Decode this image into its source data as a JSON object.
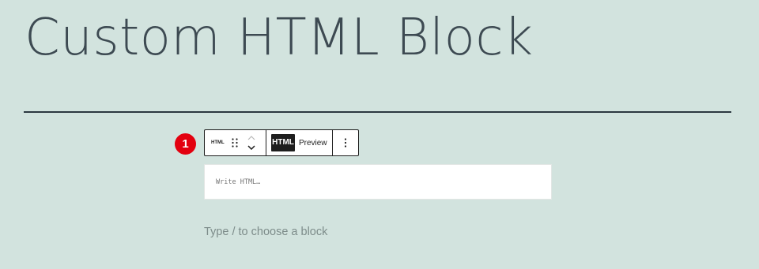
{
  "page": {
    "title": "Custom HTML Block"
  },
  "annotation": {
    "step_number": "1",
    "color": "#e3000f"
  },
  "toolbar": {
    "block_type_label": "HTML",
    "drag_icon": "drag-handle-icon",
    "move_up_icon": "chevron-up-icon",
    "move_down_icon": "chevron-down-icon",
    "html_tab_label": "HTML",
    "preview_tab_label": "Preview",
    "options_icon": "more-vertical-icon"
  },
  "editor": {
    "placeholder": "Write HTML…",
    "value": ""
  },
  "appender": {
    "text": "Type / to choose a block"
  },
  "colors": {
    "background": "#d2e3de",
    "title_text": "#3d4a52",
    "separator": "#2b3840",
    "toolbar_active_tab": "#1e1e1e"
  }
}
